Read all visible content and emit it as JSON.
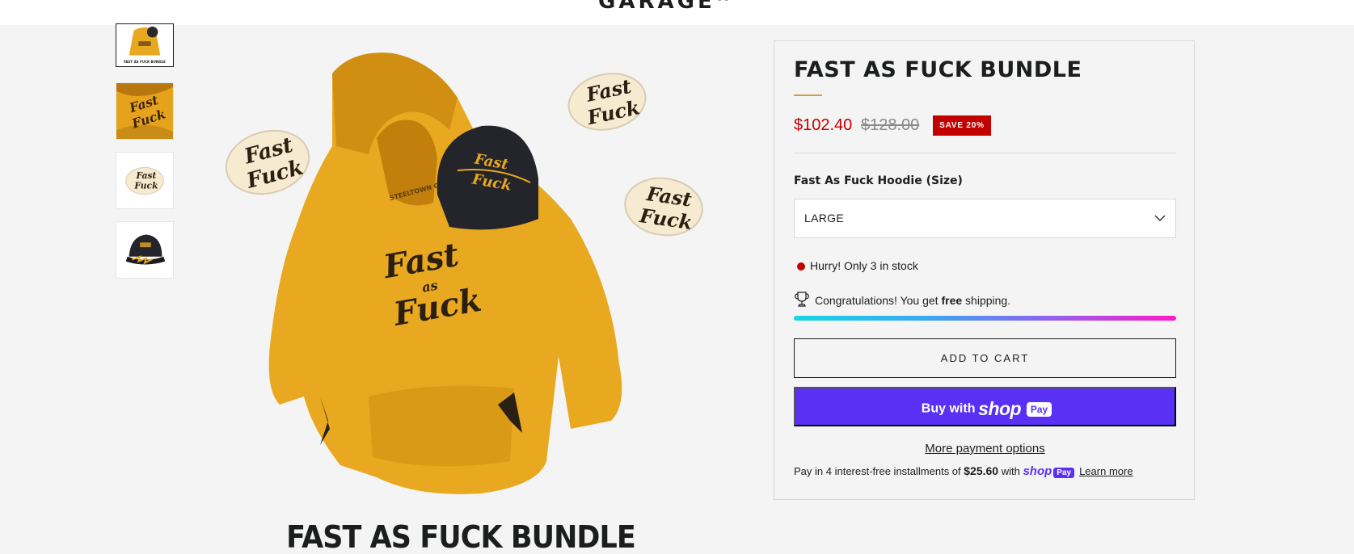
{
  "header": {
    "logo_text": "GARAGE",
    "logo_sup": "Co"
  },
  "gallery": {
    "thumbnails": [
      {
        "alt": "hoodie bundle",
        "caption": "FAST AS FUCK BUNDLE"
      },
      {
        "alt": "hoodie closeup"
      },
      {
        "alt": "sticker"
      },
      {
        "alt": "hat"
      }
    ],
    "main_caption": "FAST AS FUCK BUNDLE",
    "sticker_text_1": "Fast",
    "sticker_text_2": "as",
    "sticker_text_3": "Fuck",
    "hoodie_label": "STEELTOWN GARAGE"
  },
  "product": {
    "title": "FAST AS FUCK BUNDLE",
    "price": "$102.40",
    "compare_price": "$128.00",
    "save_badge": "SAVE 20%",
    "option_label": "Fast As Fuck Hoodie (Size)",
    "option_value": "LARGE",
    "stock_text": "Hurry! Only 3 in stock",
    "shipping": {
      "prefix": "Congratulations! You get ",
      "bold": "free",
      "suffix": " shipping."
    },
    "add_to_cart": "ADD TO CART",
    "shop_pay": {
      "buy_with": "Buy with",
      "shop": "shop",
      "pay": "Pay"
    },
    "more_payment": "More payment options",
    "installments": {
      "prefix": "Pay in 4 interest-free installments of ",
      "amount": "$25.60",
      "with": " with ",
      "shop": "shop",
      "pay": "Pay",
      "learn_more": "Learn more"
    }
  },
  "colors": {
    "sale_red": "#c20000",
    "shop_pay_purple": "#5a31f4",
    "accent_gold": "#c7a242",
    "hoodie": "#e8a81f"
  }
}
